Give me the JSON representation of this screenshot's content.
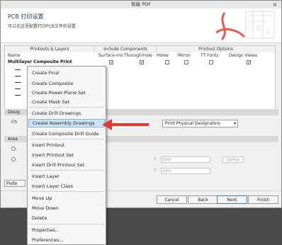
{
  "window": {
    "title": "智能 PDF",
    "close_label": "×"
  },
  "header": {
    "title": "PCB 打印设置",
    "subtitle": "可以在这里配置打印PCB文件的设置."
  },
  "grid": {
    "group_headers": [
      "Printouts & Layers",
      "Include Components",
      "Printout Options"
    ],
    "columns": [
      "Name",
      "Surface-mo",
      "Through-hole",
      "Holes",
      "Mirror",
      "TT Fonts",
      "Design Views"
    ],
    "row": {
      "name": "Multilayer Composite Print",
      "surface": true,
      "through": true,
      "holes": false,
      "mirror": false,
      "ttfonts": false,
      "design": true
    }
  },
  "sections": {
    "designators": "Desig",
    "designators_label": "Ch",
    "area": "Area",
    "prefs": "Prefe"
  },
  "designator_select": {
    "value": "Print Physical Designators"
  },
  "area": {
    "y1_label": "Y:",
    "y1_value": "0mil",
    "y2_label": "Y:",
    "y2_value": "0mil",
    "define": "Define"
  },
  "buttons": {
    "cancel": "Cancel",
    "back": "Back",
    "next": "Next",
    "finish": "Finish"
  },
  "menu": {
    "items": [
      "Create Final",
      "Create Composite",
      "Create Power-Plane Set",
      "Create Mask Set",
      "Create Drill Drawings",
      "Create Assembly Drawings",
      "Create Composite Drill Guide",
      "Insert Printout",
      "Insert Printout Set",
      "Insert Drill Printout Set",
      "Insert Layer",
      "Insert Layer Class",
      "Move Up",
      "Move Down",
      "Delete",
      "Properties...",
      "Preferences..."
    ],
    "highlighted": "Create Assembly Drawings"
  },
  "colors": {
    "accent": "#3b78d8",
    "highlight": "#cde3f7",
    "arrow": "#e03a3a"
  }
}
